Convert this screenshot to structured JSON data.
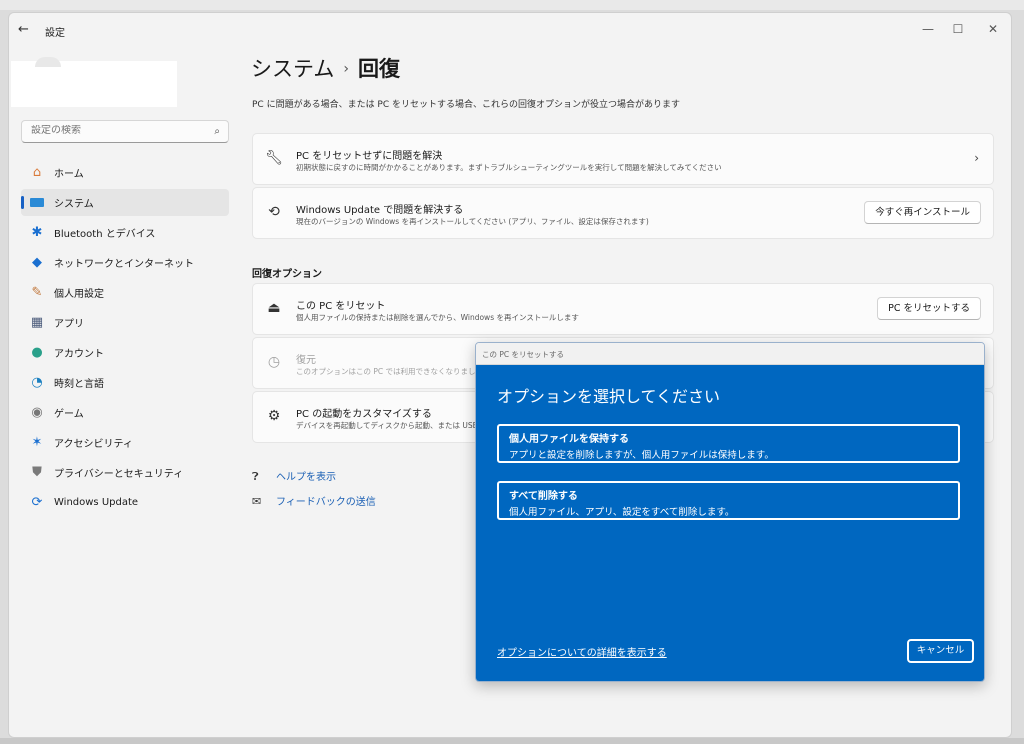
{
  "colors": {
    "accent": "#1760c4",
    "dialog_bg": "#0067c0",
    "link": "#1a5fb4"
  },
  "window": {
    "title": "設定",
    "back_icon": "back-arrow-icon",
    "minimize": "—",
    "maximize": "☐",
    "close": "✕"
  },
  "sidebar": {
    "search_placeholder": "設定の検索",
    "items": [
      {
        "label": "ホーム",
        "icon": "home-icon"
      },
      {
        "label": "システム",
        "icon": "system-icon",
        "active": true
      },
      {
        "label": "Bluetooth とデバイス",
        "icon": "bluetooth-icon"
      },
      {
        "label": "ネットワークとインターネット",
        "icon": "wifi-icon"
      },
      {
        "label": "個人用設定",
        "icon": "brush-icon"
      },
      {
        "label": "アプリ",
        "icon": "apps-icon"
      },
      {
        "label": "アカウント",
        "icon": "account-icon"
      },
      {
        "label": "時刻と言語",
        "icon": "time-language-icon"
      },
      {
        "label": "ゲーム",
        "icon": "gamepad-icon"
      },
      {
        "label": "アクセシビリティ",
        "icon": "accessibility-icon"
      },
      {
        "label": "プライバシーとセキュリティ",
        "icon": "shield-icon"
      },
      {
        "label": "Windows Update",
        "icon": "windows-update-icon"
      }
    ]
  },
  "main": {
    "breadcrumb_parent": "システム",
    "breadcrumb_sep": "›",
    "breadcrumb_current": "回復",
    "subtitle": "PC に問題がある場合、または PC をリセットする場合、これらの回復オプションが役立つ場合があります",
    "cards": [
      {
        "title": "PC をリセットせずに問題を解決",
        "desc": "初期状態に戻すのに時間がかかることがあります。まずトラブルシューティングツールを実行して問題を解決してみてください",
        "chevron": "›"
      },
      {
        "title": "Windows Update で問題を解決する",
        "desc": "現在のバージョンの Windows を再インストールしてください (アプリ、ファイル、設定は保存されます)",
        "button": "今すぐ再インストール"
      }
    ],
    "section_title": "回復オプション",
    "recovery_cards": [
      {
        "title": "この PC をリセット",
        "desc": "個人用ファイルの保持または削除を選んでから、Windows を再インストールします",
        "button": "PC をリセットする"
      },
      {
        "title": "復元",
        "desc": "このオプションはこの PC では利用できなくなりまし"
      },
      {
        "title": "PC の起動をカスタマイズする",
        "desc": "デバイスを再起動してディスクから起動、または USB"
      }
    ],
    "links": [
      {
        "label": "ヘルプを表示"
      },
      {
        "label": "フィードバックの送信"
      }
    ]
  },
  "dialog": {
    "title": "この PC をリセットする",
    "heading": "オプションを選択してください",
    "options": [
      {
        "title": "個人用ファイルを保持する",
        "desc": "アプリと設定を削除しますが、個人用ファイルは保持します。"
      },
      {
        "title": "すべて削除する",
        "desc": "個人用ファイル、アプリ、設定をすべて削除します。"
      }
    ],
    "details_link": "オプションについての詳細を表示する",
    "cancel": "キャンセル"
  }
}
